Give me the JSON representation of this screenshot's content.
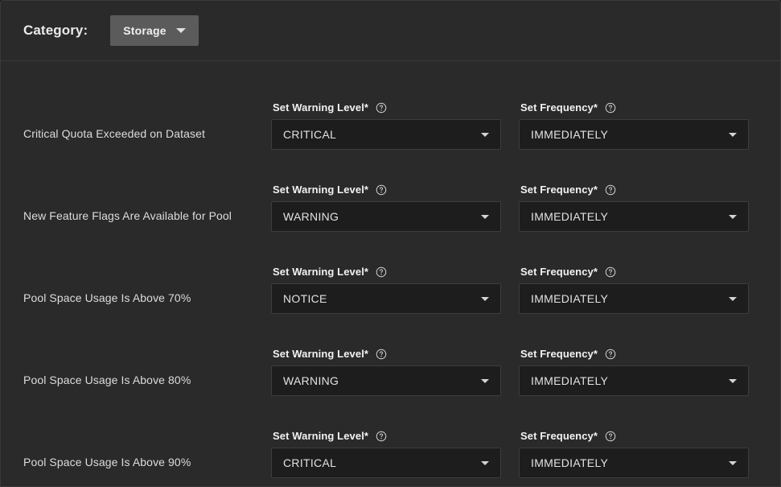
{
  "header": {
    "category_label": "Category:",
    "selected_category": "Storage",
    "caret_icon": "chevron-down-icon"
  },
  "field_labels": {
    "warning_level": "Set Warning Level",
    "frequency": "Set Frequency",
    "required_marker": "*",
    "help_icon": "help-circle-icon",
    "dropdown_icon": "chevron-down-icon"
  },
  "rows": [
    {
      "title": "Critical Quota Exceeded on Dataset",
      "warning_level": "CRITICAL",
      "frequency": "IMMEDIATELY"
    },
    {
      "title": "New Feature Flags Are Available for Pool",
      "warning_level": "WARNING",
      "frequency": "IMMEDIATELY"
    },
    {
      "title": "Pool Space Usage Is Above 70%",
      "warning_level": "NOTICE",
      "frequency": "IMMEDIATELY"
    },
    {
      "title": "Pool Space Usage Is Above 80%",
      "warning_level": "WARNING",
      "frequency": "IMMEDIATELY"
    },
    {
      "title": "Pool Space Usage Is Above 90%",
      "warning_level": "CRITICAL",
      "frequency": "IMMEDIATELY"
    }
  ],
  "colors": {
    "page_background": "#1c1c1c",
    "card_background": "#2a2a2a",
    "card_border": "#3a3a3a",
    "button_background": "#5b5b5b",
    "select_background": "#1d1d1d",
    "select_border": "#3d3d3d",
    "text_primary": "#f2f2f2",
    "text_secondary": "#dcdcdc"
  }
}
